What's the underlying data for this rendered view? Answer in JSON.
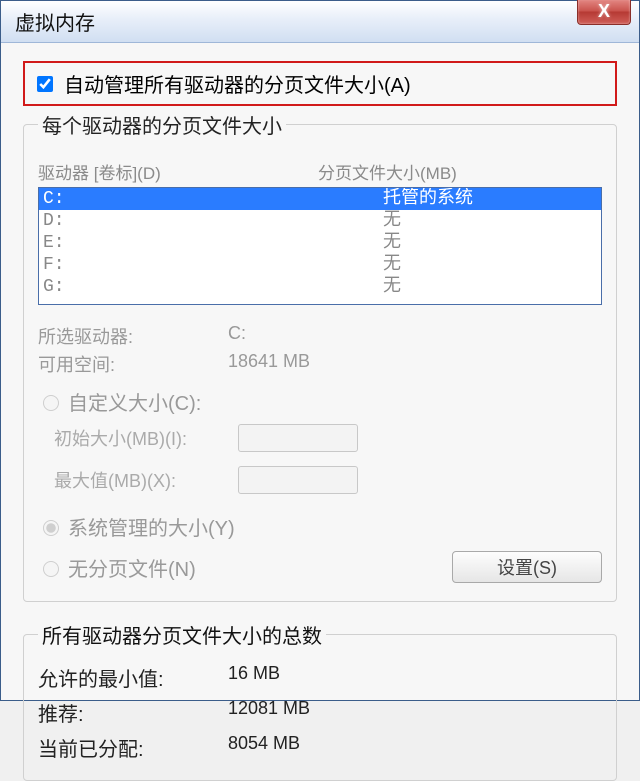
{
  "window": {
    "title": "虚拟内存",
    "close_glyph": "X"
  },
  "auto_manage": {
    "label": "自动管理所有驱动器的分页文件大小(A)",
    "checked": true
  },
  "per_drive": {
    "legend": "每个驱动器的分页文件大小",
    "header_drive": "驱动器 [卷标](D)",
    "header_size": "分页文件大小(MB)",
    "rows": [
      {
        "drive": "C:",
        "size": "托管的系统",
        "selected": true
      },
      {
        "drive": "D:",
        "size": "无",
        "selected": false
      },
      {
        "drive": "E:",
        "size": "无",
        "selected": false
      },
      {
        "drive": "F:",
        "size": "无",
        "selected": false
      },
      {
        "drive": "G:",
        "size": "无",
        "selected": false
      }
    ],
    "selected_drive_label": "所选驱动器:",
    "selected_drive_value": "C:",
    "free_space_label": "可用空间:",
    "free_space_value": "18641 MB",
    "custom_size_label": "自定义大小(C):",
    "initial_label": "初始大小(MB)(I):",
    "max_label": "最大值(MB)(X):",
    "system_managed_label": "系统管理的大小(Y)",
    "no_paging_label": "无分页文件(N)",
    "set_button": "设置(S)",
    "selected_mode": "system"
  },
  "totals": {
    "legend": "所有驱动器分页文件大小的总数",
    "min_label": "允许的最小值:",
    "min_value": "16 MB",
    "rec_label": "推荐:",
    "rec_value": "12081 MB",
    "cur_label": "当前已分配:",
    "cur_value": "8054 MB"
  }
}
